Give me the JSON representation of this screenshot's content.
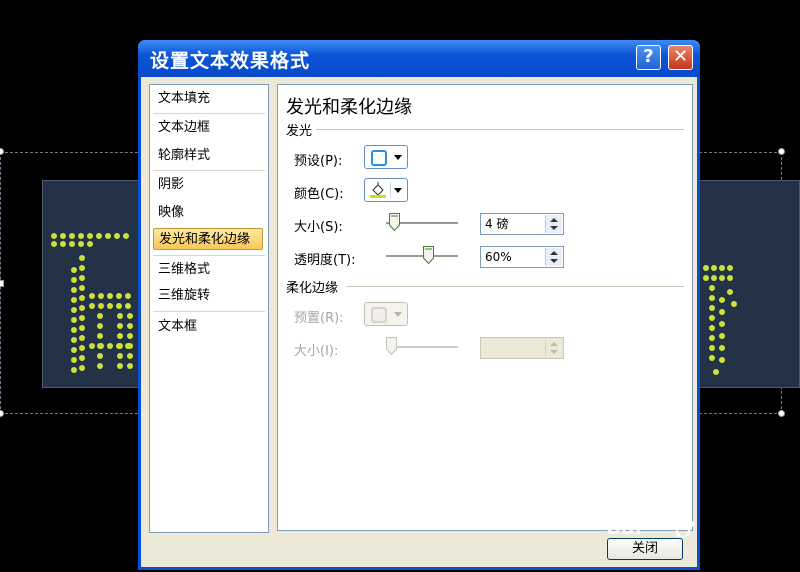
{
  "dialog": {
    "title": "设置文本效果格式",
    "help_label": "?",
    "close_label": "✕",
    "close_button_label": "关闭"
  },
  "nav": {
    "items": [
      {
        "label": "文本填充",
        "active": false
      },
      {
        "label": "文本边框",
        "active": false
      },
      {
        "label": "轮廓样式",
        "active": false
      },
      {
        "label": "阴影",
        "active": false
      },
      {
        "label": "映像",
        "active": false
      },
      {
        "label": "发光和柔化边缘",
        "active": true
      },
      {
        "label": "三维格式",
        "active": false
      },
      {
        "label": "三维旋转",
        "active": false
      },
      {
        "label": "文本框",
        "active": false
      }
    ]
  },
  "panel": {
    "title": "发光和柔化边缘",
    "glow": {
      "group_label": "发光",
      "preset_label": "预设(P):",
      "color_label": "颜色(C):",
      "size_label": "大小(S):",
      "size_value": "4 磅",
      "size_slider_fraction": 0.05,
      "transparency_label": "透明度(T):",
      "transparency_value": "60%",
      "transparency_slider_fraction": 0.6,
      "swatch_color": "#2b8fe0",
      "fill_bar_color": "#c8e020"
    },
    "soft_edges": {
      "group_label": "柔化边缘",
      "preset_label": "预置(R):",
      "size_label": "大小(I):",
      "size_value": "",
      "size_slider_fraction": 0.0,
      "disabled": true
    }
  },
  "watermark": {
    "text": "Bai"
  },
  "colors": {
    "title_bar": "#0d56d8",
    "dot_glow": "#d7ea3c",
    "slide_box": "#243247",
    "nav_active": "#f7c859"
  }
}
